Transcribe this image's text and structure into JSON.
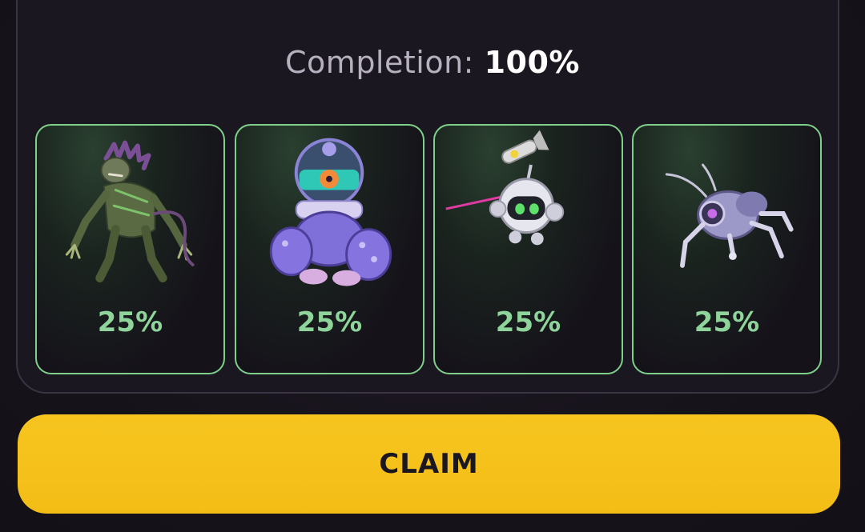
{
  "completion": {
    "label": "Completion:",
    "value": "100%"
  },
  "cards": [
    {
      "name": "zombie-beast",
      "share": "25%"
    },
    {
      "name": "purple-diver-robot",
      "share": "25%"
    },
    {
      "name": "orb-drone",
      "share": "25%"
    },
    {
      "name": "spider-bot",
      "share": "25%"
    }
  ],
  "claim": {
    "label": "CLAIM"
  },
  "colors": {
    "accent_green": "#8fd49a",
    "claim_yellow": "#f5c11a",
    "background": "#17131b"
  }
}
